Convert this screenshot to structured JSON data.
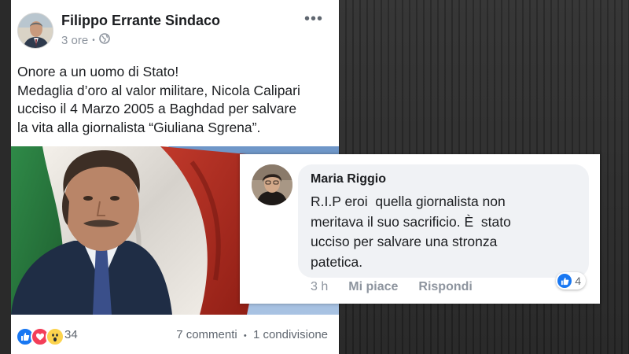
{
  "post": {
    "author": "Filippo Errante Sindaco",
    "time": "3 ore",
    "text_lines": [
      "Onore a un uomo di Stato!",
      "Medaglia d’oro al valor militare, Nicola Calipari",
      "ucciso il 4 Marzo 2005 a Baghdad per salvare",
      "la vita alla giornalista “Giuliana Sgrena”."
    ],
    "reactions_count": "34",
    "comments": "7 commenti",
    "separator": "•",
    "shares": "1 condivisione",
    "reaction_types": [
      "like-icon",
      "love-icon",
      "wow-icon"
    ],
    "icons": {
      "more": "more-options-icon",
      "audience": "globe-icon"
    }
  },
  "comment": {
    "name": "Maria Riggio",
    "text_lines": [
      "R.I.P eroi  quella giornalista non",
      "meritava il suo sacrificio. È  stato",
      "ucciso per salvare una stronza",
      "patetica."
    ],
    "time": "3 h",
    "like_label": "Mi piace",
    "reply_label": "Rispondi",
    "likes": "4"
  },
  "colors": {
    "fb_blue": "#1877f2",
    "love_red": "#f33e58",
    "wow_yellow": "#fcd34d",
    "text_primary": "#1c1e21",
    "text_secondary": "#606770"
  }
}
